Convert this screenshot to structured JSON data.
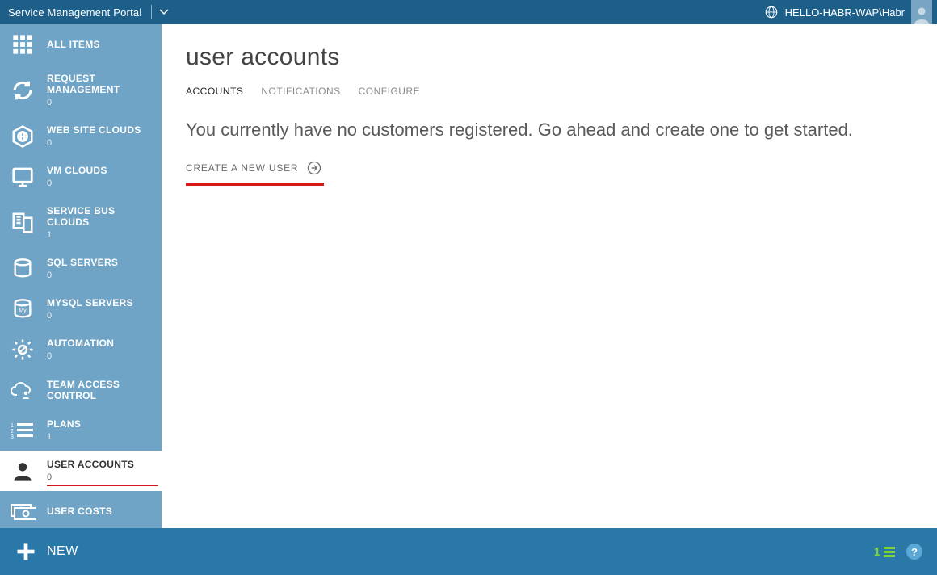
{
  "header": {
    "title": "Service Management Portal",
    "user": "HELLO-HABR-WAP\\Habr"
  },
  "sidebar": {
    "items": [
      {
        "id": "all-items",
        "label": "ALL ITEMS",
        "count": null,
        "icon": "grid"
      },
      {
        "id": "request-mgmt",
        "label": "REQUEST MANAGEMENT",
        "count": "0",
        "icon": "cycle"
      },
      {
        "id": "website-clouds",
        "label": "WEB SITE CLOUDS",
        "count": "0",
        "icon": "globe"
      },
      {
        "id": "vm-clouds",
        "label": "VM CLOUDS",
        "count": "0",
        "icon": "monitor"
      },
      {
        "id": "service-bus",
        "label": "SERVICE BUS CLOUDS",
        "count": "1",
        "icon": "bus"
      },
      {
        "id": "sql-servers",
        "label": "SQL SERVERS",
        "count": "0",
        "icon": "db"
      },
      {
        "id": "mysql-servers",
        "label": "MYSQL SERVERS",
        "count": "0",
        "icon": "mysql"
      },
      {
        "id": "automation",
        "label": "AUTOMATION",
        "count": "0",
        "icon": "gear"
      },
      {
        "id": "team-access",
        "label": "TEAM ACCESS CONTROL",
        "count": null,
        "icon": "cloud-person"
      },
      {
        "id": "plans",
        "label": "PLANS",
        "count": "1",
        "icon": "list"
      },
      {
        "id": "user-accounts",
        "label": "USER ACCOUNTS",
        "count": "0",
        "icon": "person"
      },
      {
        "id": "user-costs",
        "label": "USER COSTS",
        "count": null,
        "icon": "money"
      }
    ],
    "active_id": "user-accounts"
  },
  "main": {
    "title": "user accounts",
    "tabs": [
      {
        "id": "accounts",
        "label": "ACCOUNTS"
      },
      {
        "id": "notifications",
        "label": "NOTIFICATIONS"
      },
      {
        "id": "configure",
        "label": "CONFIGURE"
      }
    ],
    "active_tab": "accounts",
    "empty_message": "You currently have no customers registered. Go ahead and create one to get started.",
    "create_label": "CREATE A NEW USER"
  },
  "bottombar": {
    "new_label": "NEW",
    "notif_count": "1"
  }
}
